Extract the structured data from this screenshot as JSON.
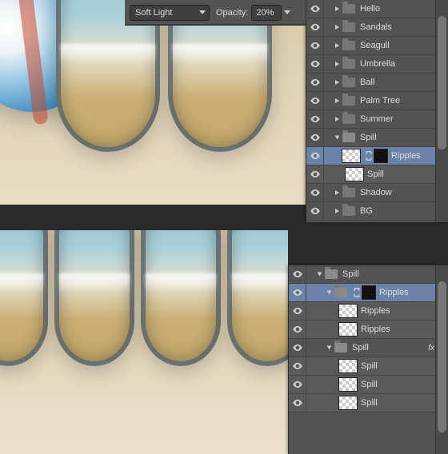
{
  "options_bar": {
    "blend_mode": "Soft Light",
    "opacity_label": "Opacity:",
    "opacity_value": "20%"
  },
  "panel_top": {
    "rows": [
      {
        "type": "group",
        "name": "Hello"
      },
      {
        "type": "group",
        "name": "Sandals"
      },
      {
        "type": "group",
        "name": "Seagull"
      },
      {
        "type": "group",
        "name": "Umbrella"
      },
      {
        "type": "group",
        "name": "Ball"
      },
      {
        "type": "group",
        "name": "Palm Tree"
      },
      {
        "type": "group",
        "name": "Summer"
      },
      {
        "type": "group_open",
        "name": "Spill"
      },
      {
        "type": "layer_masked_sel",
        "name": "Ripples"
      },
      {
        "type": "layer",
        "name": "Spill"
      },
      {
        "type": "group",
        "name": "Shadow"
      },
      {
        "type": "group",
        "name": "BG"
      }
    ]
  },
  "panel_bottom": {
    "rows": [
      {
        "type": "group_open",
        "name": "Spill"
      },
      {
        "type": "group_open_masked_sel",
        "name": "Ripples"
      },
      {
        "type": "layer",
        "name": "Ripples"
      },
      {
        "type": "layer",
        "name": "Ripples"
      },
      {
        "type": "group_open_fx",
        "name": "Spill"
      },
      {
        "type": "layer3",
        "name": "Spill"
      },
      {
        "type": "layer3",
        "name": "Spill"
      },
      {
        "type": "layer3",
        "name": "Spill"
      }
    ],
    "fx_label": "fx"
  }
}
